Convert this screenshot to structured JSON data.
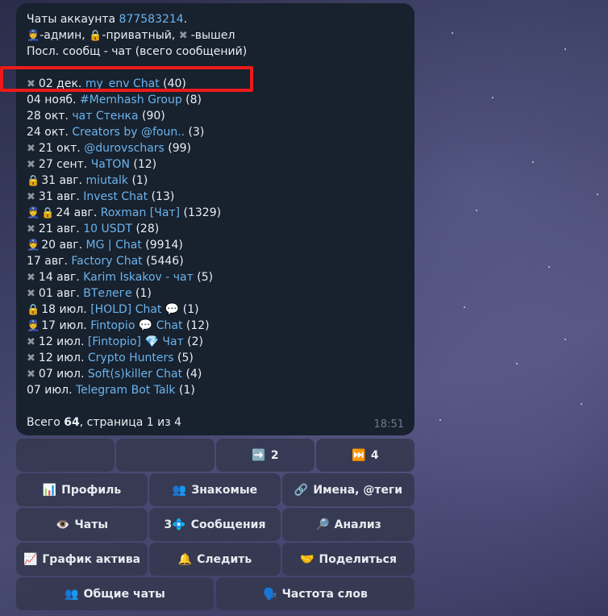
{
  "message": {
    "header": {
      "title_prefix": "Чаты аккаунта",
      "account_id": "877583214",
      "title_suffix": ".",
      "legend_admin": "-админ,",
      "legend_private": "-приватный,",
      "legend_left": "-вышел",
      "subtitle": "Посл. сообщ - чат (всего сообщений)"
    },
    "chats": [
      {
        "date": "02 дек.",
        "name": "my_env Chat",
        "count": "(40)",
        "icons": "x"
      },
      {
        "date": "04 нояб.",
        "name": "#Memhash Group",
        "count": "(8)",
        "icons": ""
      },
      {
        "date": "28 окт.",
        "name": "чат Стенка",
        "count": "(90)",
        "icons": ""
      },
      {
        "date": "24 окт.",
        "name": "Creators by @foun..",
        "count": "(3)",
        "icons": ""
      },
      {
        "date": "21 окт.",
        "name": "@durovschars",
        "count": "(99)",
        "icons": "x"
      },
      {
        "date": "27 сент.",
        "name": "ЧаТON",
        "count": "(12)",
        "icons": "x"
      },
      {
        "date": "31 авг.",
        "name": "miutalk",
        "count": "(1)",
        "icons": "lock"
      },
      {
        "date": "31 авг.",
        "name": "Invest Chat",
        "count": "(13)",
        "icons": "x"
      },
      {
        "date": "24 авг.",
        "name": "Roxman [Чат]",
        "count": "(1329)",
        "icons": "cop-lock"
      },
      {
        "date": "21 авг.",
        "name": "10 USDT",
        "count": "(28)",
        "icons": "x"
      },
      {
        "date": "20 авг.",
        "name": "MG | Chat",
        "count": "(9914)",
        "icons": "cop"
      },
      {
        "date": "17 авг.",
        "name": "Factory Chat",
        "count": "(5446)",
        "icons": ""
      },
      {
        "date": "14 авг.",
        "name": "Karim Iskakov - чат",
        "count": "(5)",
        "icons": "x"
      },
      {
        "date": "01 авг.",
        "name": "ВТелеге",
        "count": "(1)",
        "icons": "x"
      },
      {
        "date": "18 июл.",
        "name": "[HOLD] Chat",
        "name_suffix": "💬",
        "count": "(1)",
        "icons": "lock"
      },
      {
        "date": "17 июл.",
        "name": "Fintopio",
        "name_mid": "💬",
        "name2": "Chat",
        "count": "(12)",
        "icons": "cop"
      },
      {
        "date": "12 июл.",
        "name": "[Fintopio]",
        "name_mid": "💎",
        "name2": "Чат",
        "count": "(2)",
        "icons": "x"
      },
      {
        "date": "12 июл.",
        "name": "Crypto Hunters",
        "count": "(5)",
        "icons": "x"
      },
      {
        "date": "07 июл.",
        "name": "Soft(s)killer Chat",
        "count": "(4)",
        "icons": "x"
      },
      {
        "date": "07 июл.",
        "name": "Telegram Bot Talk",
        "count": "(1)",
        "icons": ""
      }
    ],
    "footer": {
      "total_label": "Всего",
      "total": "64",
      "page_text": ", страница 1 из 4"
    },
    "time": "18:51"
  },
  "keyboard": {
    "row1": [
      {
        "label": ""
      },
      {
        "label": ""
      },
      {
        "icon": "➡️",
        "label": "2"
      },
      {
        "icon": "⏭️",
        "label": "4"
      }
    ],
    "row2": [
      {
        "icon": "📊",
        "label": "Профиль"
      },
      {
        "icon": "👥",
        "label": "Знакомые"
      },
      {
        "icon": "🔗",
        "label": "Имена, @теги"
      }
    ],
    "row3": [
      {
        "icon": "👁️",
        "label": "Чаты"
      },
      {
        "icon_prefix": "3",
        "icon": "💠",
        "label": "Сообщения"
      },
      {
        "icon": "🔎",
        "label": "Анализ"
      }
    ],
    "row4": [
      {
        "icon": "📈",
        "label": "График актива"
      },
      {
        "icon": "🔔",
        "label": "Следить"
      },
      {
        "icon": "🤝",
        "label": "Поделиться"
      }
    ],
    "row5": [
      {
        "icon": "👥",
        "label": "Общие чаты"
      },
      {
        "icon": "🗣️",
        "label": "Частота слов"
      }
    ]
  },
  "icons": {
    "admin": "police-officer-icon",
    "private": "lock-icon",
    "left": "cross-icon"
  }
}
